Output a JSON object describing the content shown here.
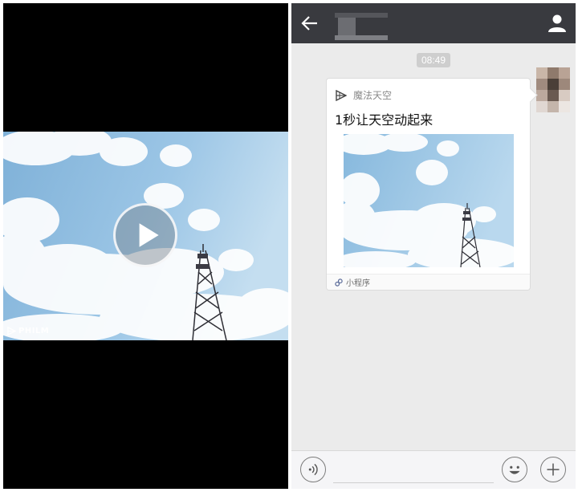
{
  "video": {
    "watermark": "PHILM",
    "play_icon": "play-icon",
    "scene": "sky-clouds-with-radio-tower"
  },
  "chat": {
    "header": {
      "back_icon": "back-arrow-icon",
      "contact_name_redacted": true,
      "profile_icon": "person-icon",
      "background": "#393a3f"
    },
    "timestamp": "08:49",
    "message": {
      "app_name": "魔法天空",
      "app_icon": "philm-logo-icon",
      "title": "1秒让天空动起来",
      "footer_label": "小程序",
      "footer_icon": "mini-program-icon"
    },
    "input_bar": {
      "voice_icon": "voice-icon",
      "emoji_icon": "emoji-icon",
      "more_icon": "plus-icon",
      "placeholder": ""
    },
    "background": "#ebebeb"
  }
}
